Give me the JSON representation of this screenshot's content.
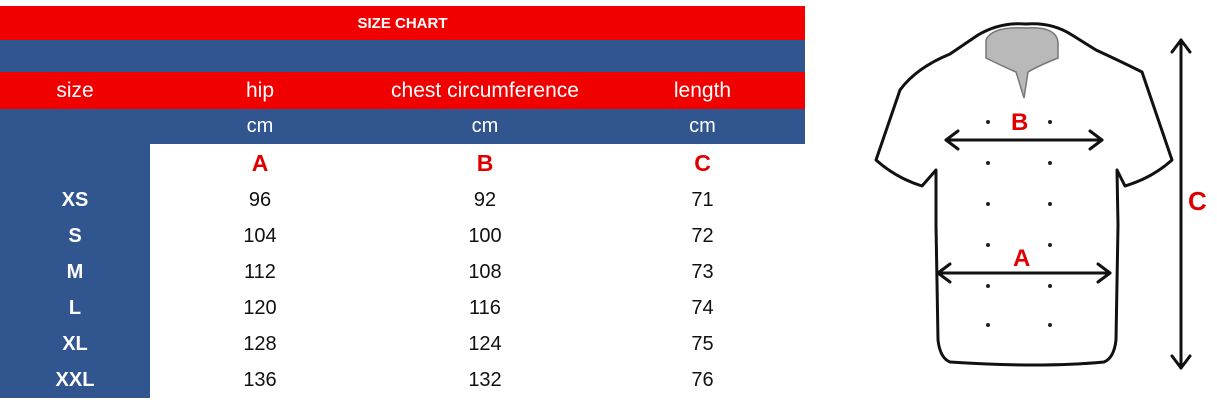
{
  "title": "SIZE CHART",
  "header": {
    "size": "size",
    "hip": "hip",
    "chest": "chest circumference",
    "length": "length"
  },
  "units": {
    "hip": "cm",
    "chest": "cm",
    "length": "cm"
  },
  "letters": {
    "hip": "A",
    "chest": "B",
    "length": "C"
  },
  "rows": [
    {
      "size": "XS",
      "hip": "96",
      "chest": "92",
      "length": "71"
    },
    {
      "size": "S",
      "hip": "104",
      "chest": "100",
      "length": "72"
    },
    {
      "size": "M",
      "hip": "112",
      "chest": "108",
      "length": "73"
    },
    {
      "size": "L",
      "hip": "120",
      "chest": "116",
      "length": "74"
    },
    {
      "size": "XL",
      "hip": "128",
      "chest": "124",
      "length": "75"
    },
    {
      "size": "XXL",
      "hip": "136",
      "chest": "132",
      "length": "76"
    }
  ],
  "illustration": {
    "label_a": "A",
    "label_b": "B",
    "label_c": "C"
  },
  "colors": {
    "red": "#f10000",
    "blue": "#30558f",
    "letter_red": "#e00000"
  }
}
